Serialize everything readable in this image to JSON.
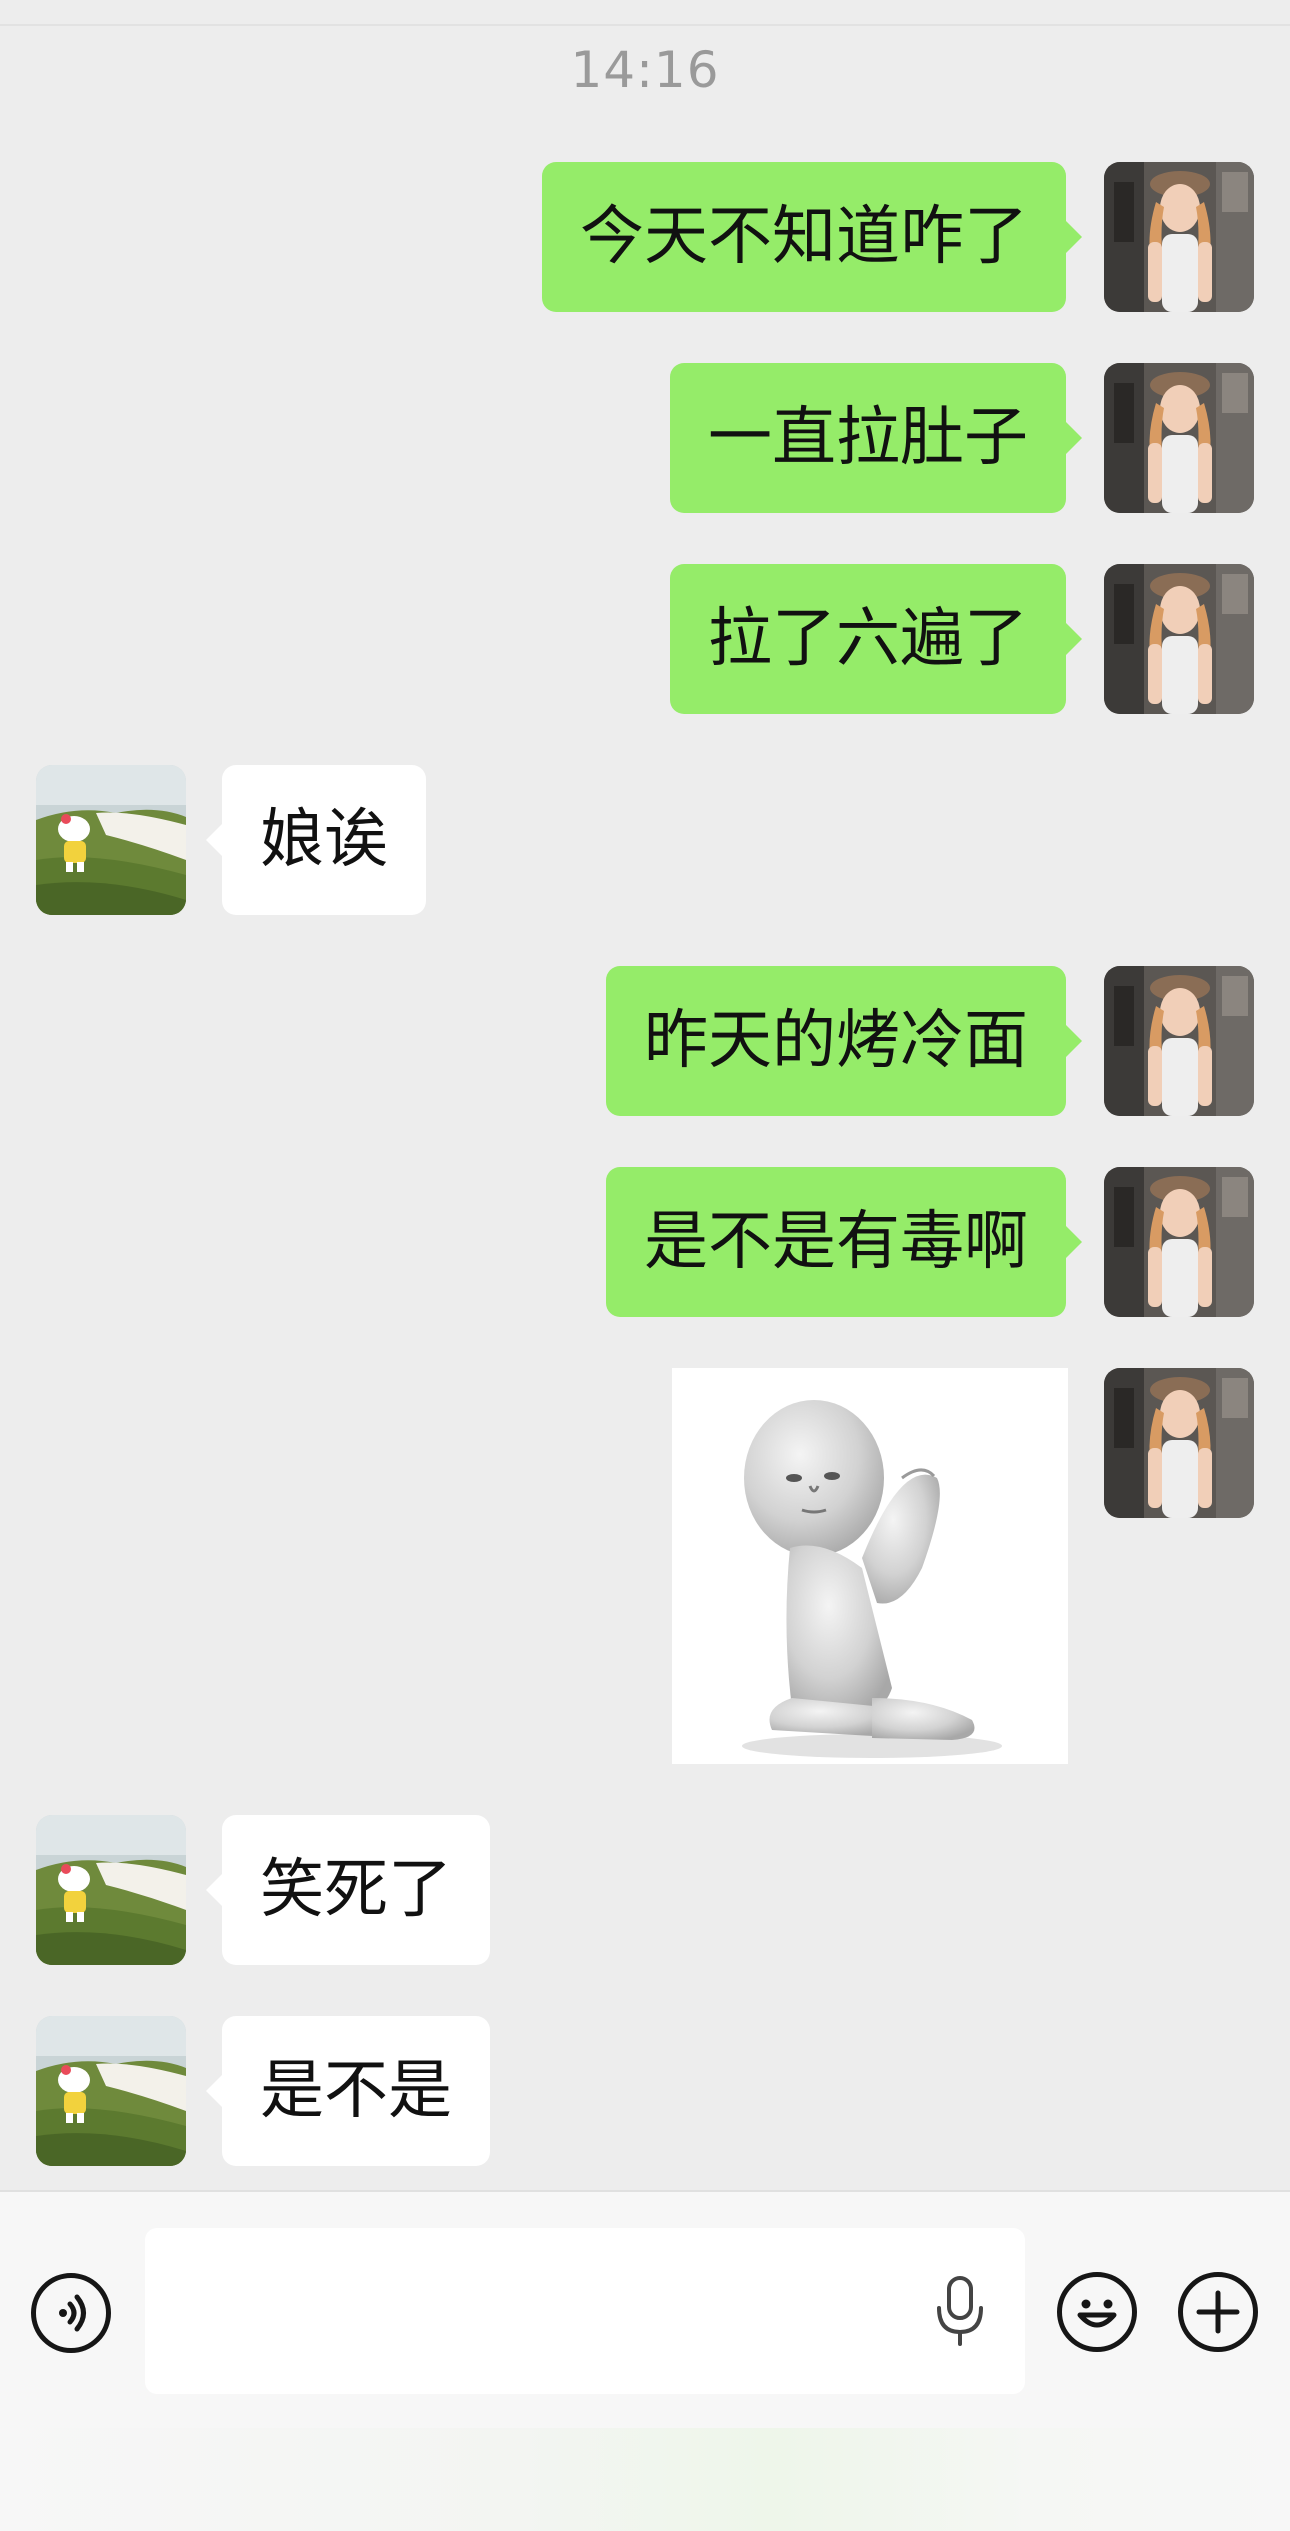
{
  "status": {
    "time": "14:16"
  },
  "messages": [
    {
      "sender": "me",
      "text": "今天不知道咋了"
    },
    {
      "sender": "me",
      "text": "一直拉肚子"
    },
    {
      "sender": "me",
      "text": "拉了六遍了"
    },
    {
      "sender": "peer",
      "text": "娘诶"
    },
    {
      "sender": "me",
      "text": "昨天的烤冷面"
    },
    {
      "sender": "me",
      "text": "是不是有毒啊"
    },
    {
      "sender": "me",
      "type": "sticker",
      "sticker": "kneeling-praying-figure"
    },
    {
      "sender": "peer",
      "text": "笑死了"
    },
    {
      "sender": "peer",
      "text": "是不是"
    }
  ],
  "input_bar": {
    "value": "",
    "placeholder": "",
    "icons": {
      "voice": "voice-toggle-icon",
      "mic": "microphone-icon",
      "emoji": "emoji-icon",
      "more": "plus-icon"
    }
  },
  "colors": {
    "background": "#ededed",
    "outgoing_bubble": "#95ec69",
    "incoming_bubble": "#ffffff",
    "input_bar": "#f7f7f7",
    "timestamp": "#9a9a9a"
  }
}
